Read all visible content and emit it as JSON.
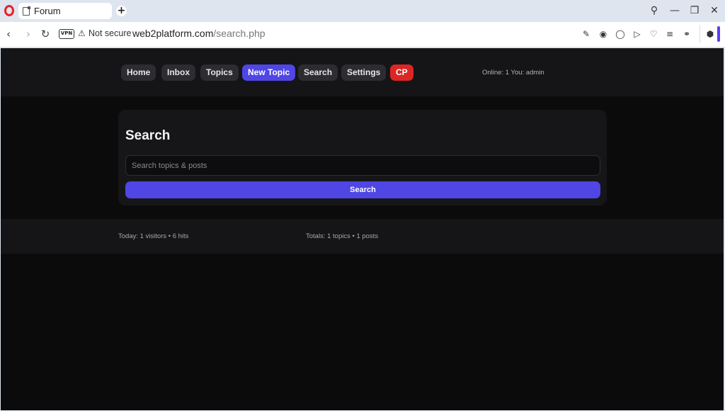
{
  "browser": {
    "tab_title": "Forum",
    "new_tab_label": "+",
    "security_label": "Not secure",
    "vpn_label": "VPN",
    "url_host": "web2platform.com",
    "url_path": "/search.php"
  },
  "nav": {
    "items": [
      {
        "label": "Home"
      },
      {
        "label": "Inbox"
      },
      {
        "label": "Topics"
      },
      {
        "label": "New Topic"
      },
      {
        "label": "Search"
      },
      {
        "label": "Settings"
      },
      {
        "label": "CP"
      }
    ],
    "online_text": "Online: 1 You: admin"
  },
  "search": {
    "title": "Search",
    "placeholder": "Search topics & posts",
    "value": "",
    "button_label": "Search"
  },
  "footer": {
    "today": "Today: 1 visitors • 6 hits",
    "totals": "Totals: 1 topics • 1 posts"
  },
  "colors": {
    "accent": "#4f46e5",
    "danger": "#dc2626",
    "background": "#0b0b0c"
  }
}
